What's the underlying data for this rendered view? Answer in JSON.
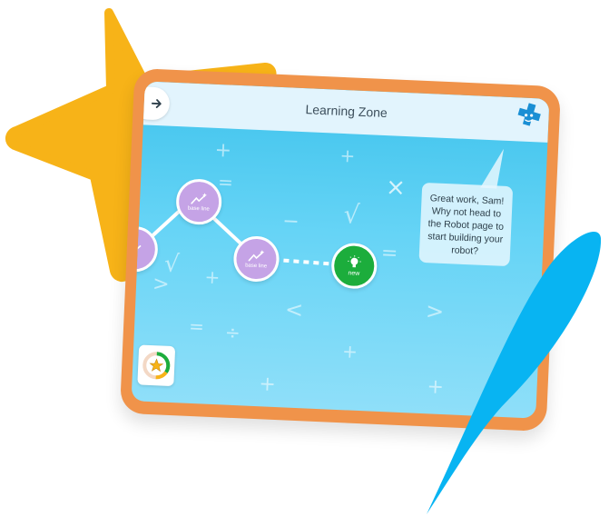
{
  "app": {
    "title": "Learning Zone",
    "back_icon": "arrow-right-icon",
    "logo_icon": "robot-logo-icon"
  },
  "message": {
    "text": "Great work, Sam! Why not head to the Robot page to start building your robot?"
  },
  "path": {
    "nodes": [
      {
        "id": "node-partial",
        "label": "",
        "status": "completed",
        "icon": "sparkle-chart-icon"
      },
      {
        "id": "node-1",
        "label": "base line",
        "status": "completed",
        "icon": "sparkle-chart-icon"
      },
      {
        "id": "node-2",
        "label": "base line",
        "status": "completed",
        "icon": "sparkle-chart-icon"
      },
      {
        "id": "node-new",
        "label": "new",
        "status": "new",
        "icon": "lightbulb-icon"
      }
    ]
  },
  "progress": {
    "icon": "star-icon",
    "level": 0.35
  },
  "colors": {
    "frame": "#f0934a",
    "star": "#f7b318",
    "streak": "#08b4f2",
    "node_done": "#c5a3e6",
    "node_new": "#1cad3c",
    "sky_top": "#3fc3ec"
  }
}
